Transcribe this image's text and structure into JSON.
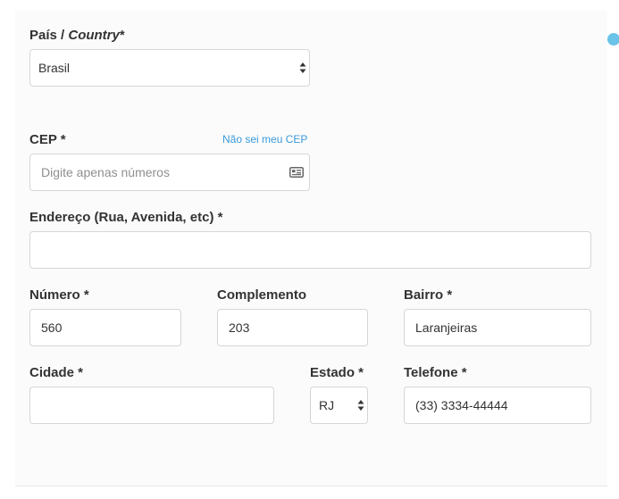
{
  "form": {
    "country": {
      "label_prefix": "País / ",
      "label_italic": "Country",
      "required_mark": "*",
      "value": "Brasil"
    },
    "cep": {
      "label": "CEP *",
      "link": "Não sei meu CEP",
      "placeholder": "Digite apenas números",
      "icon": "address-card-icon"
    },
    "address": {
      "label": "Endereço (Rua, Avenida, etc) *",
      "value": ""
    },
    "number": {
      "label": "Número *",
      "value": "560"
    },
    "complement": {
      "label": "Complemento",
      "value": "203"
    },
    "neighborhood": {
      "label": "Bairro *",
      "value": "Laranjeiras"
    },
    "city": {
      "label": "Cidade *",
      "value": ""
    },
    "state": {
      "label": "Estado *",
      "value": "RJ"
    },
    "phone": {
      "label": "Telefone *",
      "value": "(33) 3334-44444"
    }
  },
  "colors": {
    "link": "#3a9ad9",
    "label": "#333333",
    "border": "#d6d6d6",
    "accent_dot": "#6cc3ea"
  }
}
